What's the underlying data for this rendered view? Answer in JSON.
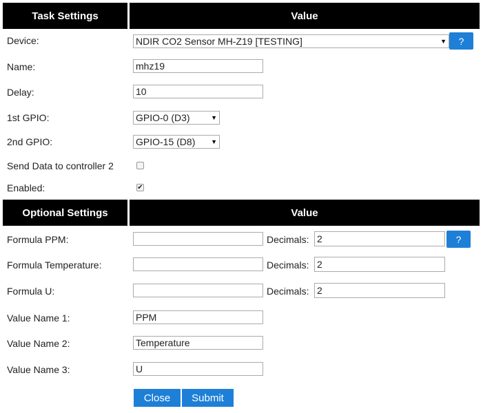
{
  "task_header": {
    "label": "Task Settings",
    "value": "Value"
  },
  "device": {
    "label": "Device:",
    "selected": "NDIR CO2 Sensor MH-Z19 [TESTING]"
  },
  "help_label": "?",
  "name": {
    "label": "Name:",
    "value": "mhz19"
  },
  "delay": {
    "label": "Delay:",
    "value": "10"
  },
  "gpio1": {
    "label": "1st GPIO:",
    "selected": "GPIO-0 (D3)"
  },
  "gpio2": {
    "label": "2nd GPIO:",
    "selected": "GPIO-15 (D8)"
  },
  "send_data": {
    "label": "Send Data to controller 2",
    "checked": false
  },
  "enabled": {
    "label": "Enabled:",
    "checked": true
  },
  "optional_header": {
    "label": "Optional Settings",
    "value": "Value"
  },
  "formula_ppm": {
    "label": "Formula PPM:",
    "value": "",
    "decimals_label": "Decimals:",
    "decimals": "2"
  },
  "formula_temp": {
    "label": "Formula Temperature:",
    "value": "",
    "decimals_label": "Decimals:",
    "decimals": "2"
  },
  "formula_u": {
    "label": "Formula U:",
    "value": "",
    "decimals_label": "Decimals:",
    "decimals": "2"
  },
  "value_name_1": {
    "label": "Value Name 1:",
    "value": "PPM"
  },
  "value_name_2": {
    "label": "Value Name 2:",
    "value": "Temperature"
  },
  "value_name_3": {
    "label": "Value Name 3:",
    "value": "U"
  },
  "buttons": {
    "close": "Close",
    "submit": "Submit"
  },
  "colors": {
    "header_bg": "#000000",
    "accent": "#1e7fd7"
  }
}
